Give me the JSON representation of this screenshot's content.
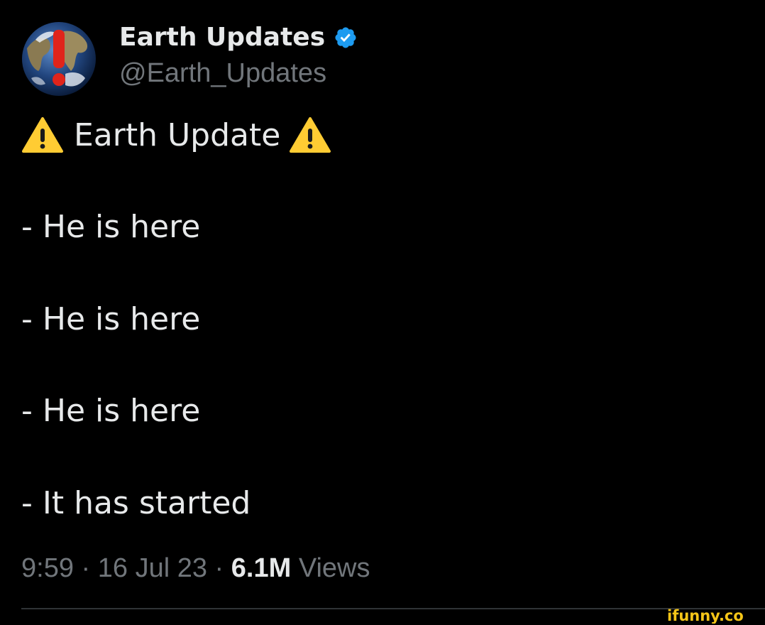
{
  "author": {
    "display_name": "Earth Updates",
    "handle": "@Earth_Updates",
    "avatar_icon": "earth-globe-alert-icon",
    "verified_icon": "verified-badge-icon",
    "verified_color": "#1d9bf0"
  },
  "tweet": {
    "heading_icon": "warning-icon",
    "heading": "Earth Update",
    "lines": [
      "- He is here",
      "- He is here",
      "- He is here",
      "- It has started"
    ]
  },
  "meta": {
    "time": "9:59",
    "separator": "·",
    "date": "16 Jul 23",
    "views_count": "6.1M",
    "views_label": "Views"
  },
  "watermark": {
    "text": "ifunny.co",
    "color": "#f5c518"
  },
  "colors": {
    "background": "#000000",
    "primary_text": "#e7e9ea",
    "secondary_text": "#71767b",
    "warning_yellow": "#ffcc33"
  }
}
